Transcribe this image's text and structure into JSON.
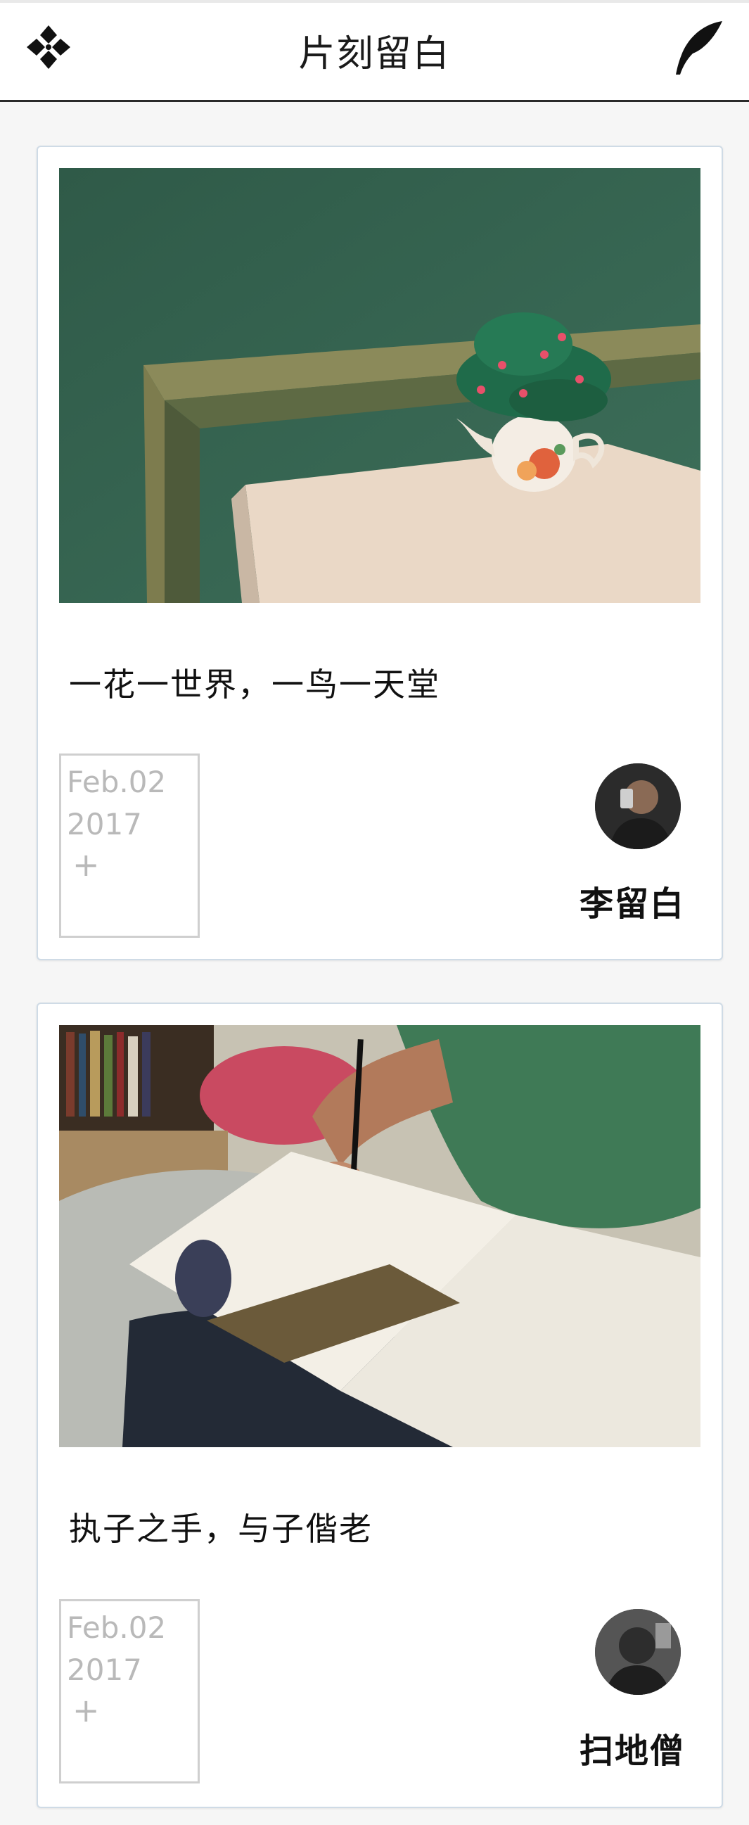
{
  "header": {
    "title": "片刻留白",
    "menu_icon": "four-diamonds-icon",
    "write_icon": "quill-feather-icon"
  },
  "posts": [
    {
      "caption": "一花一世界，一鸟一天堂",
      "date_line1": "Feb.02",
      "date_line2": "2017",
      "add_symbol": "+",
      "author": "李留白",
      "image": "teapot-plant-on-table-photo",
      "avatar": "author-avatar-photo"
    },
    {
      "caption": "执子之手，与子偕老",
      "date_line1": "Feb.02",
      "date_line2": "2017",
      "add_symbol": "+",
      "author": "扫地僧",
      "image": "person-drawing-in-sketchbook-photo",
      "avatar": "author-avatar-photo"
    }
  ],
  "colors": {
    "card_border": "#cfdbe6",
    "date_text": "#b9b9b9",
    "header_rule": "#2a2a2a"
  }
}
